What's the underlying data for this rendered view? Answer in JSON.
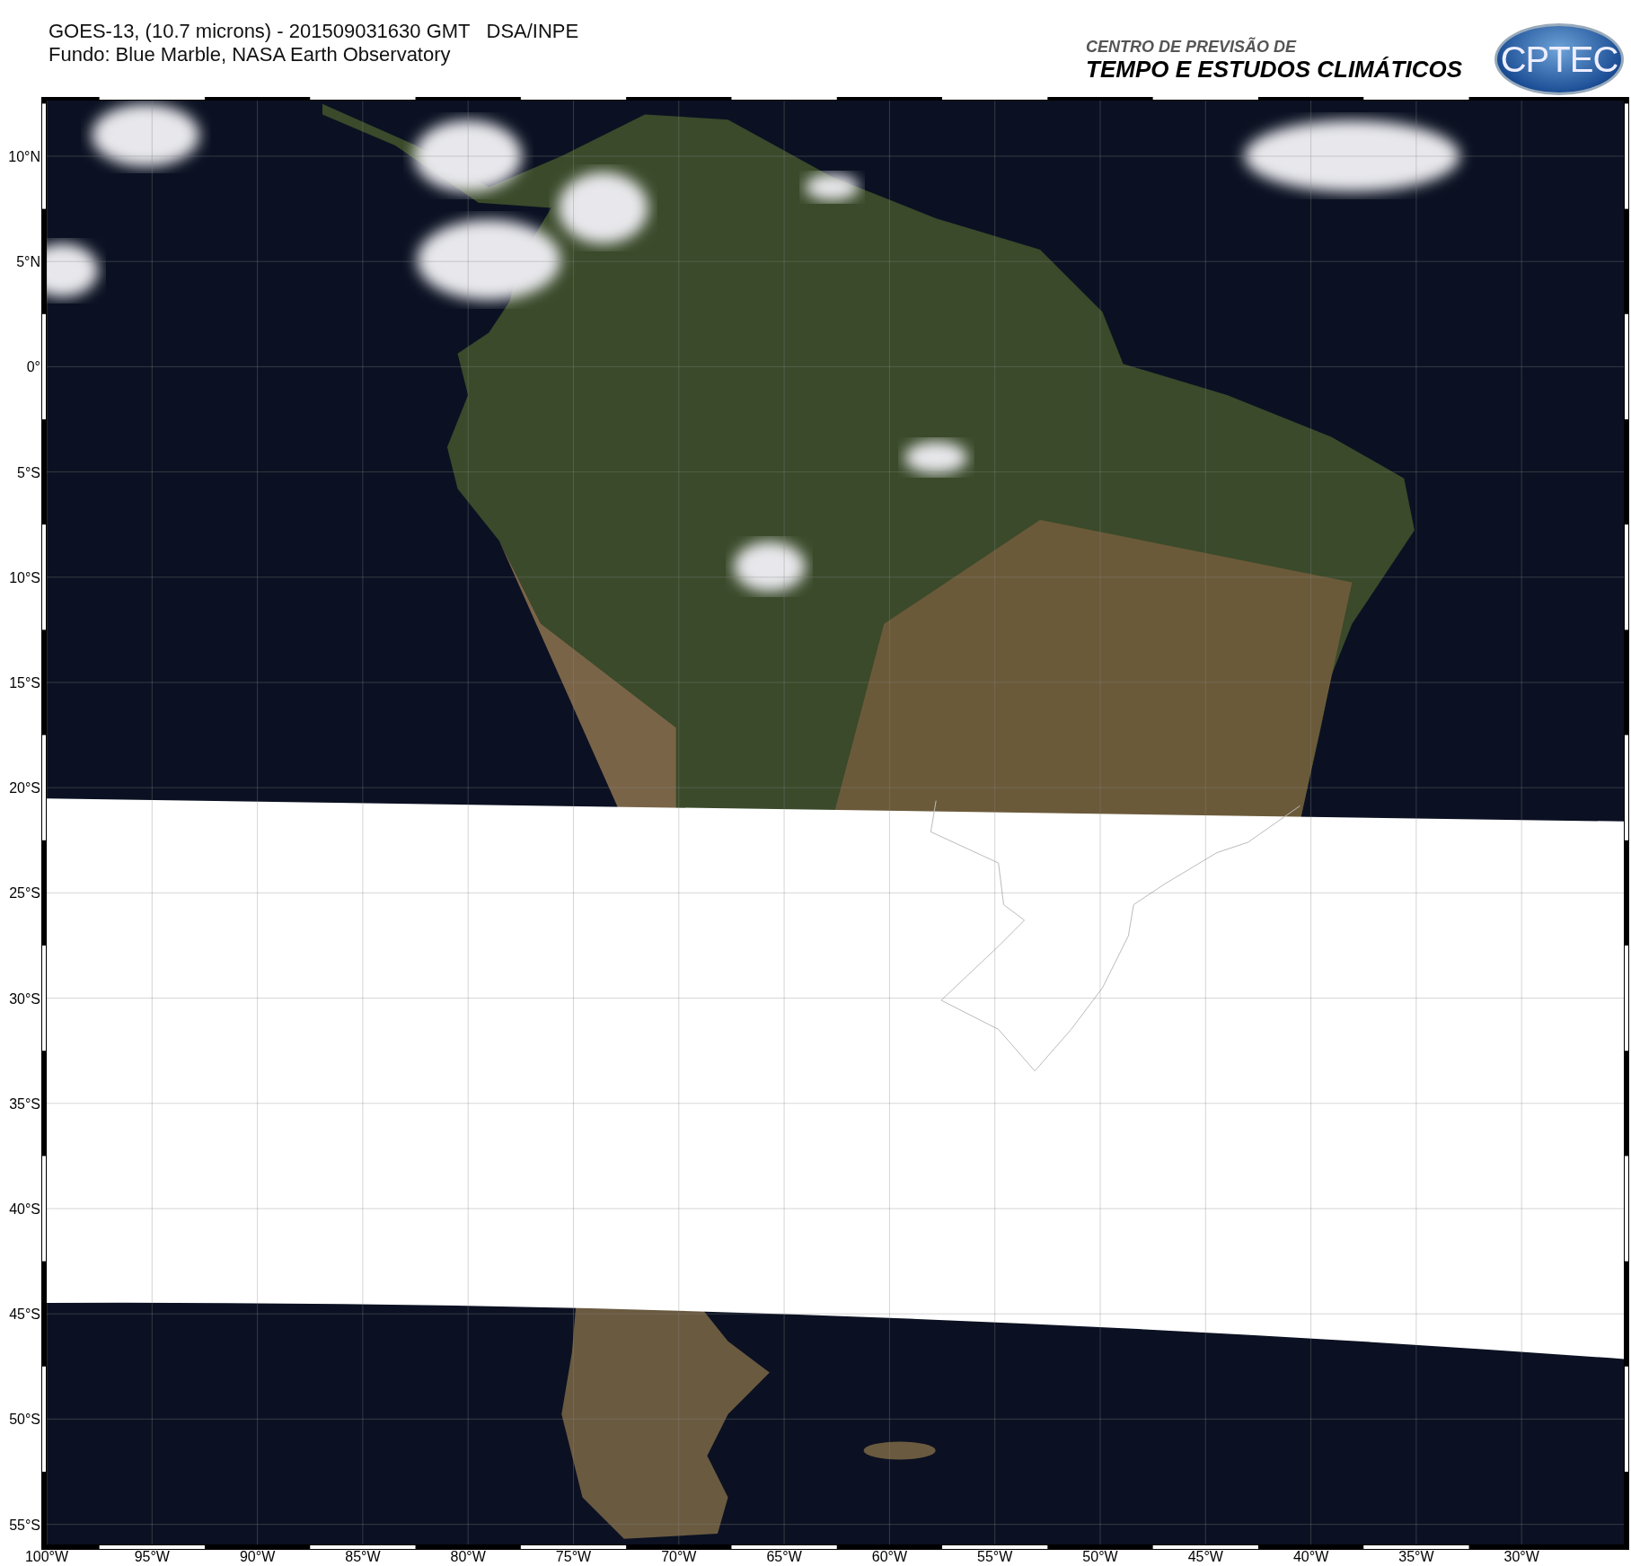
{
  "header": {
    "title": "GOES-13, (10.7 microns) - 201509031630 GMT   DSA/INPE",
    "subtitle": "Fundo: Blue Marble, NASA Earth Observatory"
  },
  "brand": {
    "line_1": "CENTRO DE PREVISÃO DE",
    "line_2": "TEMPO E ESTUDOS CLIMÁTICOS",
    "logo": "CPTEC"
  },
  "map": {
    "lat_labels": [
      "10°N",
      "5°N",
      "0°",
      "5°S",
      "10°S",
      "15°S",
      "20°S",
      "25°S",
      "30°S",
      "35°S",
      "40°S",
      "45°S",
      "50°S",
      "55°S"
    ],
    "lon_labels": [
      "100°W",
      "95°W",
      "90°W",
      "85°W",
      "80°W",
      "75°W",
      "70°W",
      "65°W",
      "60°W",
      "55°W",
      "50°W",
      "45°W",
      "40°W",
      "35°W",
      "30°W"
    ]
  }
}
